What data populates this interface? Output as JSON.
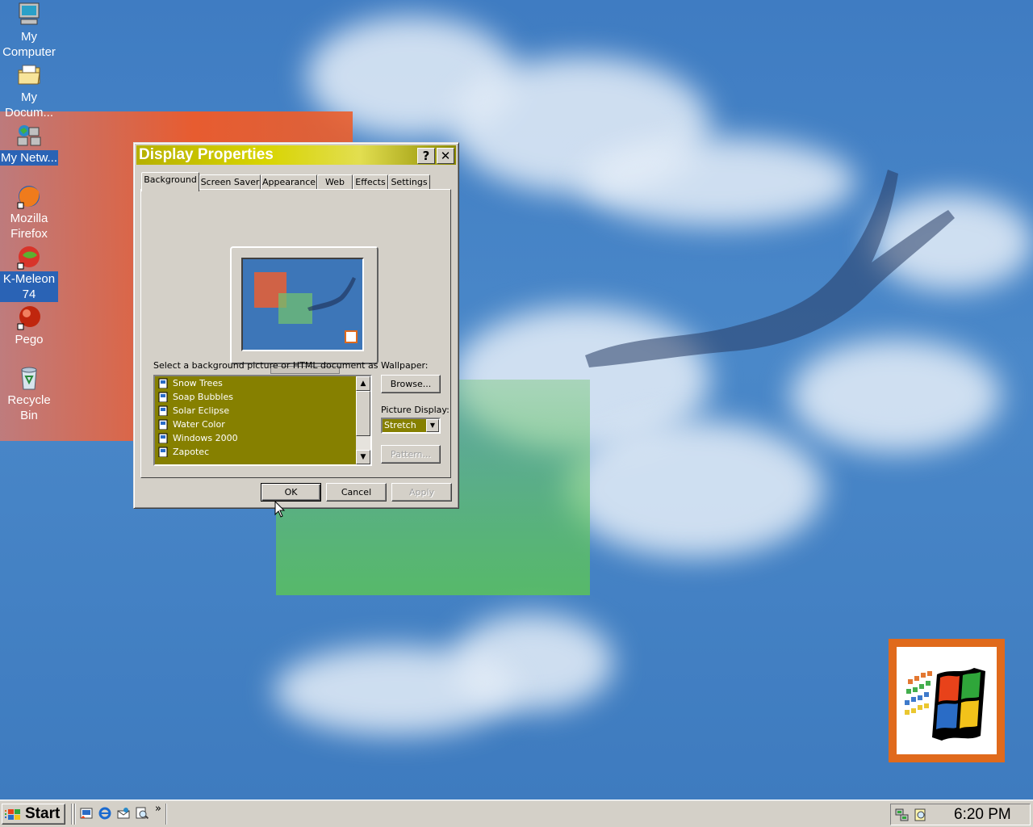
{
  "desktop": {
    "icons": [
      {
        "label": "My Computer",
        "icon": "my-computer-icon"
      },
      {
        "label": "My Docum...",
        "icon": "my-documents-icon"
      },
      {
        "label": "My Netw...",
        "icon": "my-network-icon"
      },
      {
        "label": "Mozilla Firefox",
        "icon": "firefox-icon"
      },
      {
        "label": "K-Meleon 74",
        "icon": "k-meleon-icon"
      },
      {
        "label": "Pego",
        "icon": "pego-icon"
      },
      {
        "label": "Recycle Bin",
        "icon": "recycle-bin-icon"
      }
    ]
  },
  "dialog": {
    "title": "Display Properties",
    "help_button": "?",
    "close_button": "✕",
    "tabs": [
      "Background",
      "Screen Saver",
      "Appearance",
      "Web",
      "Effects",
      "Settings"
    ],
    "active_tab": "Background",
    "wallpaper_prompt": "Select a background picture or HTML document as Wallpaper:",
    "wallpapers": [
      "Snow Trees",
      "Soap Bubbles",
      "Solar Eclipse",
      "Water Color",
      "Windows 2000",
      "Zapotec"
    ],
    "browse_button": "Browse...",
    "picture_display_label": "Picture Display:",
    "picture_display_value": "Stretch",
    "pattern_button": "Pattern...",
    "ok_button": "OK",
    "cancel_button": "Cancel",
    "apply_button": "Apply"
  },
  "taskbar": {
    "start_label": "Start",
    "clock": "6:20 PM",
    "quick_launch": [
      "show-desktop-icon",
      "internet-explorer-icon",
      "outlook-express-icon",
      "search-icon"
    ],
    "overflow": "»",
    "tray_icons": [
      "network-tray-icon",
      "search-tray-icon"
    ]
  },
  "colors": {
    "desktop_blue": "#3b78bd",
    "title_olive": "#b6b000",
    "selection_olive": "#868000",
    "face": "#d4d0c8"
  }
}
